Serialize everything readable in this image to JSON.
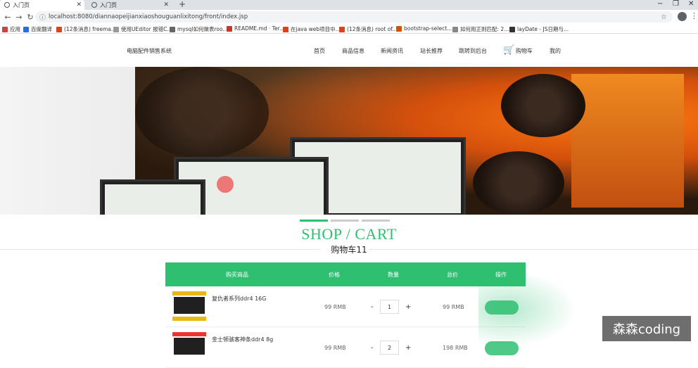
{
  "browser": {
    "tabs": [
      {
        "title": "入门页",
        "active": true
      },
      {
        "title": "入门页",
        "active": false
      }
    ],
    "url": "localhost:8080/diannaopeijianxiaoshouguanlixitong/front/index.jsp",
    "window_controls": [
      "−",
      "❐",
      "✕"
    ]
  },
  "bookmarks": [
    {
      "label": "应用",
      "color": "#c44"
    },
    {
      "label": "百度翻译",
      "color": "#2a6de0"
    },
    {
      "label": "(12条消息) freema...",
      "color": "#e0401e"
    },
    {
      "label": "使用UEditor 报错C...",
      "color": "#999"
    },
    {
      "label": "mysql如何做表roo...",
      "color": "#666"
    },
    {
      "label": "README.md · Ter...",
      "color": "#c0392b"
    },
    {
      "label": "在java web项目中...",
      "color": "#e0401e"
    },
    {
      "label": "(12条消息) root of...",
      "color": "#e0401e"
    },
    {
      "label": "bootstrap-select...",
      "color": "#d35400"
    },
    {
      "label": "如何用正则匹配: 2...",
      "color": "#888"
    },
    {
      "label": "layDate - JS日期与...",
      "color": "#333"
    }
  ],
  "site": {
    "title": "电脑配件销售系统",
    "nav": [
      "首页",
      "商品信息",
      "新闻资讯",
      "站长推荐",
      "跳转到后台",
      "购物车",
      "我的"
    ]
  },
  "section": {
    "heading": "SHOP / CART",
    "subheading": "购物车11"
  },
  "cart": {
    "columns": [
      "购买商品",
      "价格",
      "数量",
      "总价",
      "操作"
    ],
    "items": [
      {
        "name": "复仇者系列ddr4 16G",
        "price": "99 RMB",
        "qty": "1",
        "total": "99 RMB"
      },
      {
        "name": "金士顿骇客神条ddr4 8g",
        "price": "99 RMB",
        "qty": "2",
        "total": "198 RMB"
      }
    ],
    "minus": "-",
    "plus": "+"
  },
  "watermark": "森森coding",
  "colors": {
    "accent": "#2fbf71",
    "tabstrip": "#dee1e6"
  }
}
